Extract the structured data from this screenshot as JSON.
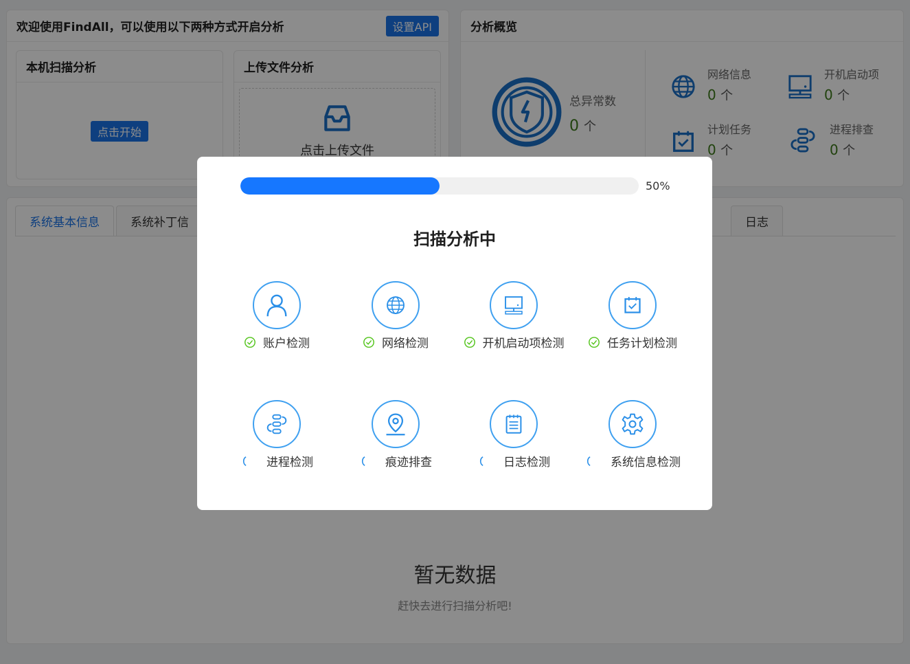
{
  "welcome": {
    "title": "欢迎使用FindAll，可以使用以下两种方式开启分析",
    "api_button": "设置API"
  },
  "local_scan": {
    "title": "本机扫描分析",
    "start_button": "点击开始"
  },
  "upload": {
    "title": "上传文件分析",
    "upload_text": "点击上传文件"
  },
  "overview": {
    "title": "分析概览",
    "total_label": "总异常数",
    "total_value": "0",
    "unit": "个",
    "items": [
      {
        "label": "网络信息",
        "value": "0",
        "icon": "globe-icon"
      },
      {
        "label": "开机启动项",
        "value": "0",
        "icon": "computer-icon"
      },
      {
        "label": "计划任务",
        "value": "0",
        "icon": "calendar-check-icon"
      },
      {
        "label": "进程排查",
        "value": "0",
        "icon": "process-flow-icon"
      }
    ]
  },
  "tabs": [
    {
      "label": "系统基本信息",
      "active": true
    },
    {
      "label": "系统补丁信"
    },
    {
      "label": "日志"
    }
  ],
  "empty": {
    "title": "暂无数据",
    "subtitle": "赶快去进行扫描分析吧!"
  },
  "modal": {
    "progress": 0.5,
    "progress_text": "50%",
    "title": "扫描分析中",
    "checks": [
      {
        "label": "账户检测",
        "status": "done",
        "icon": "user-icon"
      },
      {
        "label": "网络检测",
        "status": "done",
        "icon": "globe-icon"
      },
      {
        "label": "开机启动项检测",
        "status": "done",
        "icon": "computer-icon"
      },
      {
        "label": "任务计划检测",
        "status": "done",
        "icon": "calendar-check-icon"
      },
      {
        "label": "进程检测",
        "status": "loading",
        "icon": "process-flow-icon"
      },
      {
        "label": "痕迹排查",
        "status": "loading",
        "icon": "location-pin-icon"
      },
      {
        "label": "日志检测",
        "status": "loading",
        "icon": "notepad-icon"
      },
      {
        "label": "系统信息检测",
        "status": "loading",
        "icon": "gear-icon"
      }
    ]
  },
  "colors": {
    "primary": "#1a73e8",
    "success": "#52c41a",
    "icon_blue": "#1a6fc7"
  }
}
